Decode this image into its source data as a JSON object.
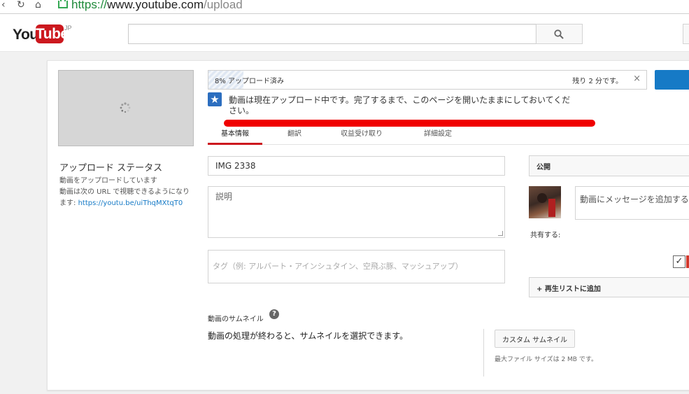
{
  "browser": {
    "url_scheme": "https://",
    "url_host": "www.youtube.com",
    "url_path": "/upload"
  },
  "header": {
    "logo_you": "You",
    "logo_tube": "Tube",
    "logo_region": "JP",
    "search_placeholder": ""
  },
  "upload": {
    "progress_percent": 8,
    "progress_label": "8% アップロード済み",
    "remaining_label": "残り 2 分です。",
    "close_label": "×",
    "notice_text": "動画は現在アップロード中です。完了するまで、このページを開いたままにしておいてください。",
    "status_title": "アップロード ステータス",
    "status_sub": "動画をアップロードしています",
    "url_text": "動画は次の URL で視聴できるようになります: ",
    "url_link": "https://youtu.be/uiThqMXtqT0"
  },
  "tabs": [
    {
      "label": "基本情報"
    },
    {
      "label": "翻訳"
    },
    {
      "label": "収益受け取り"
    },
    {
      "label": "詳細設定"
    }
  ],
  "form": {
    "title_value": "IMG 2338",
    "description_placeholder": "説明",
    "tags_placeholder": "タグ（例: アルバート・アインシュタイン、空飛ぶ豚、マッシュアップ）",
    "privacy_value": "公開",
    "message_placeholder": "動画にメッセージを追加する",
    "share_label": "共有する:",
    "playlist_label": "+ 再生リストに追加"
  },
  "thumbnail": {
    "heading": "動画のサムネイル",
    "help": "?",
    "note": "動画の処理が終わると、サムネイルを選択できます。",
    "custom_button": "カスタム サムネイル",
    "max_size": "最大ファイル サイズは 2 MB です。"
  },
  "colors": {
    "brand_red": "#cc181e",
    "link_blue": "#167ac6",
    "annotation_red": "#f00000"
  }
}
